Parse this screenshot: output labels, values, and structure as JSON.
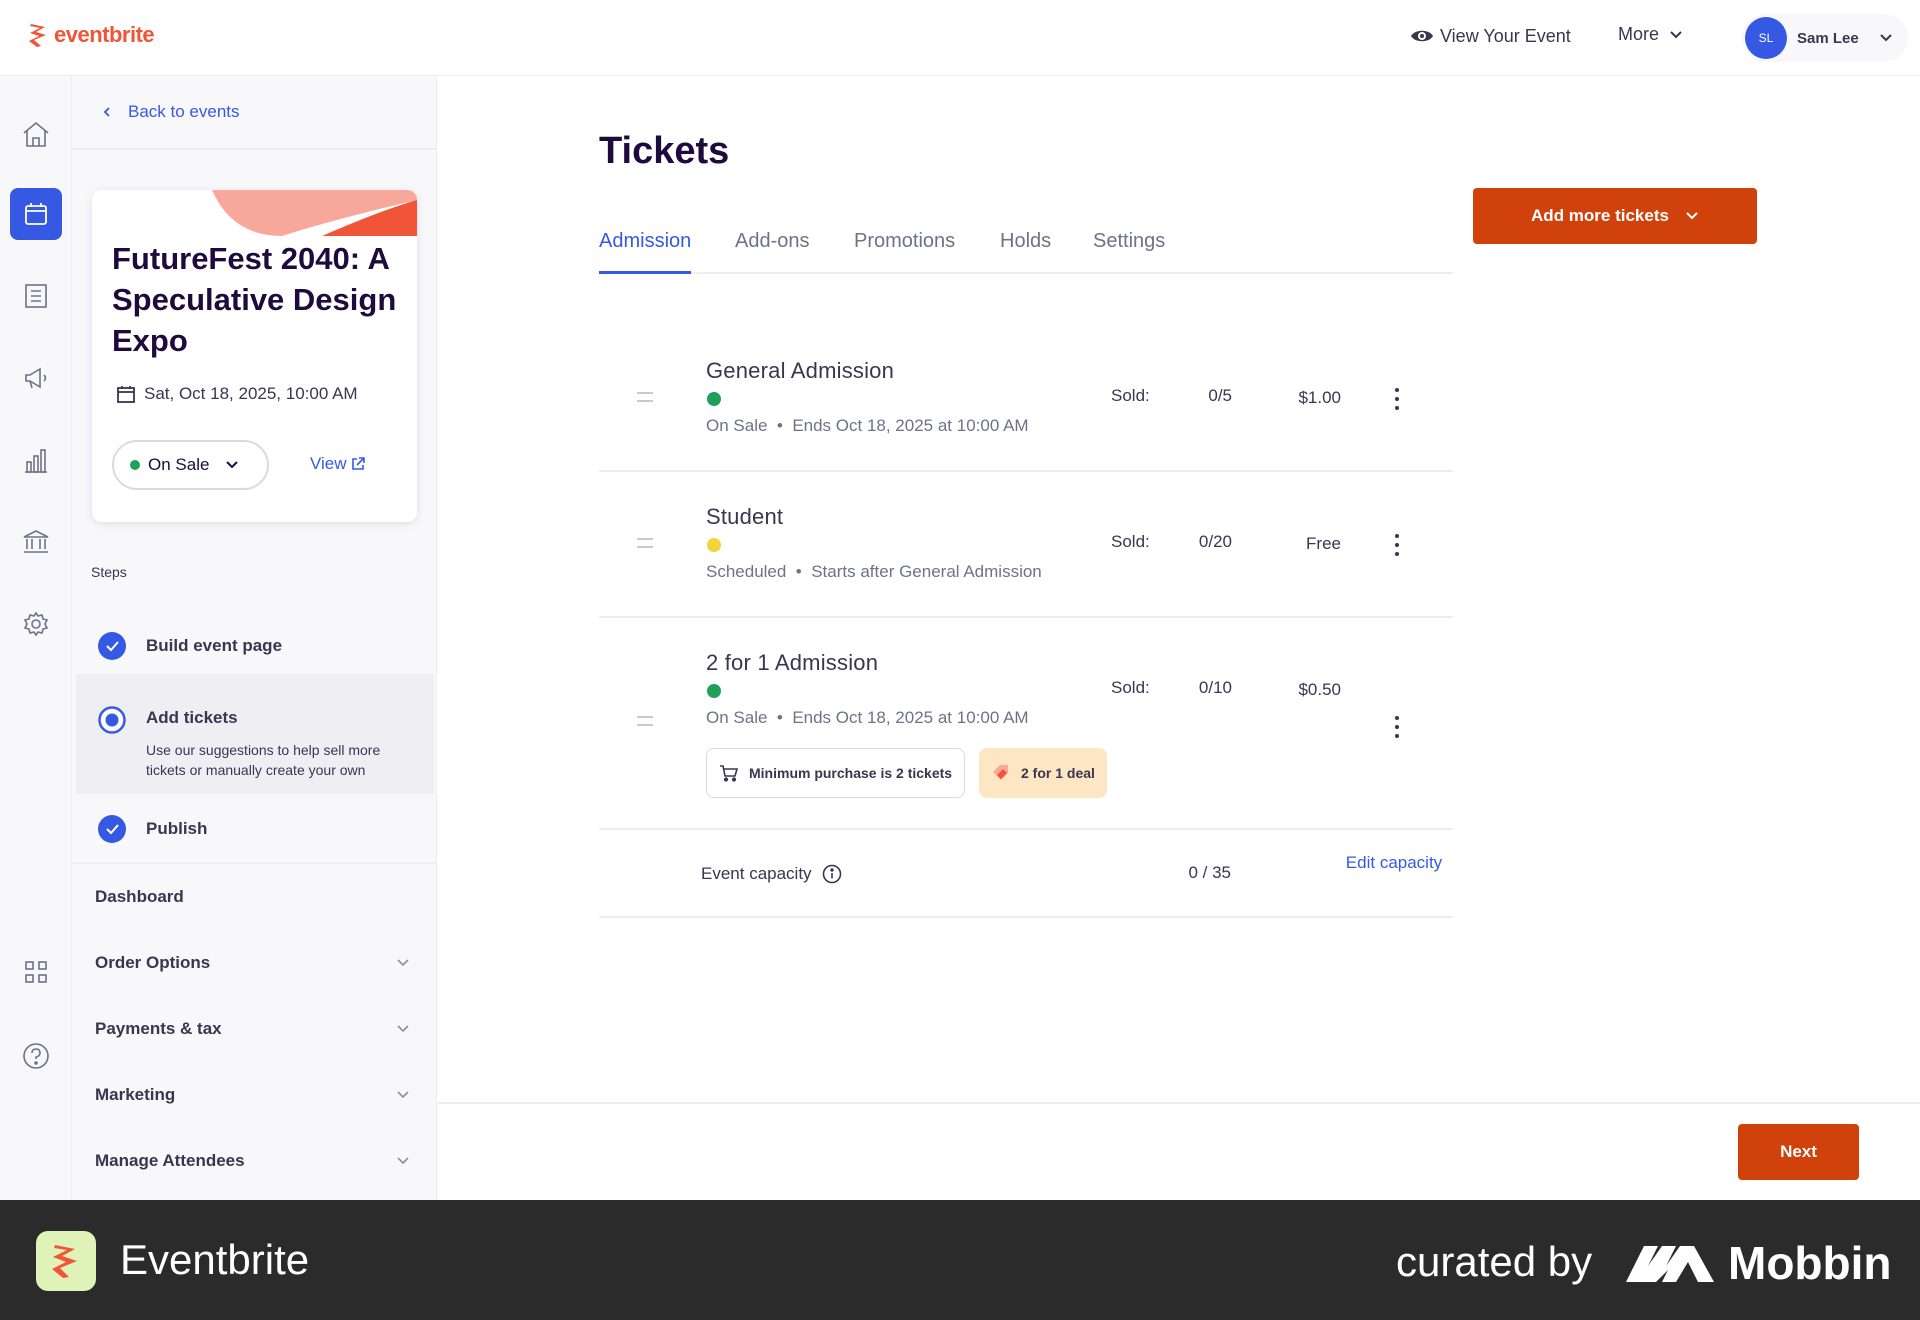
{
  "header": {
    "logo_text": "eventbrite",
    "view_event": "View Your Event",
    "more": "More",
    "user_initials": "SL",
    "user_name": "Sam Lee"
  },
  "sidebar": {
    "back": "Back to events",
    "event": {
      "title": "FutureFest 2040: A Speculative Design Expo",
      "date": "Sat, Oct 18, 2025, 10:00 AM",
      "status": "On Sale",
      "view": "View"
    },
    "steps_label": "Steps",
    "steps": [
      {
        "label": "Build event page"
      },
      {
        "label": "Add tickets",
        "description": "Use our suggestions to help sell more tickets or manually create your own"
      },
      {
        "label": "Publish"
      }
    ],
    "nav": [
      {
        "label": "Dashboard"
      },
      {
        "label": "Order Options"
      },
      {
        "label": "Payments & tax"
      },
      {
        "label": "Marketing"
      },
      {
        "label": "Manage Attendees"
      }
    ]
  },
  "main": {
    "title": "Tickets",
    "tabs": [
      {
        "label": "Admission"
      },
      {
        "label": "Add-ons"
      },
      {
        "label": "Promotions"
      },
      {
        "label": "Holds"
      },
      {
        "label": "Settings"
      }
    ],
    "add_button": "Add more tickets",
    "sold_label": "Sold:",
    "tickets": [
      {
        "name": "General Admission",
        "status": "On Sale",
        "detail": "Ends Oct 18, 2025 at 10:00 AM",
        "sold": "0/5",
        "price": "$1.00"
      },
      {
        "name": "Student",
        "status": "Scheduled",
        "detail": "Starts after General Admission",
        "sold": "0/20",
        "price": "Free"
      },
      {
        "name": "2 for 1 Admission",
        "status": "On Sale",
        "detail": "Ends Oct 18, 2025 at 10:00 AM",
        "sold": "0/10",
        "price": "$0.50",
        "tags": [
          "Minimum purchase is 2 tickets",
          "2 for 1 deal"
        ]
      }
    ],
    "capacity": {
      "label": "Event capacity",
      "value": "0 / 35",
      "edit": "Edit capacity"
    },
    "next": "Next"
  },
  "banner": {
    "app_name": "Eventbrite",
    "curated": "curated by",
    "brand": "Mobbin"
  },
  "colors": {
    "accent": "#3659e3",
    "primary_button": "#d1410c",
    "on_sale": "#1fa15a",
    "scheduled": "#f2d33b"
  }
}
